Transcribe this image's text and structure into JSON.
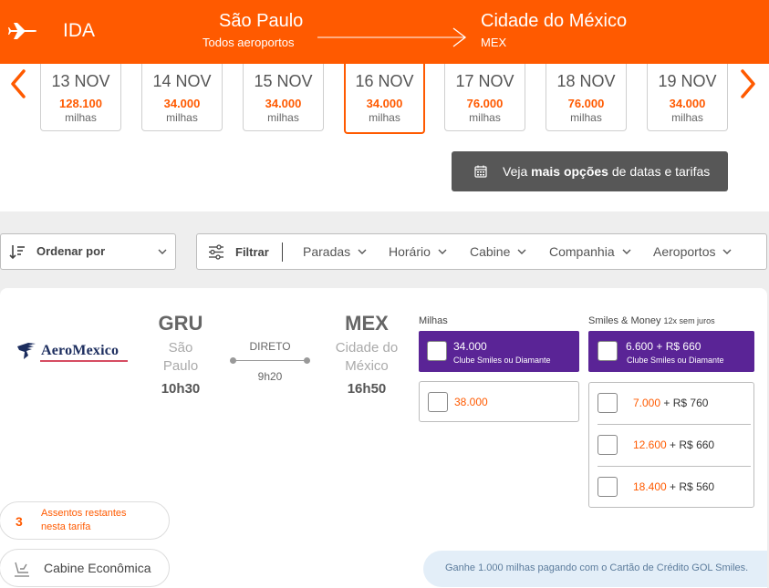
{
  "header": {
    "direction": "IDA",
    "origin": {
      "city": "São Paulo",
      "airports": "Todos aeroportos"
    },
    "destination": {
      "city": "Cidade do México",
      "code": "MEX"
    },
    "color": "#ff5a00"
  },
  "dates": [
    {
      "date": "13 NOV",
      "price": "128.100",
      "unit": "milhas",
      "selected": false
    },
    {
      "date": "14 NOV",
      "price": "34.000",
      "unit": "milhas",
      "selected": false
    },
    {
      "date": "15 NOV",
      "price": "34.000",
      "unit": "milhas",
      "selected": false
    },
    {
      "date": "16 NOV",
      "price": "34.000",
      "unit": "milhas",
      "selected": true
    },
    {
      "date": "17 NOV",
      "price": "76.000",
      "unit": "milhas",
      "selected": false
    },
    {
      "date": "18 NOV",
      "price": "76.000",
      "unit": "milhas",
      "selected": false
    },
    {
      "date": "19 NOV",
      "price": "34.000",
      "unit": "milhas",
      "selected": false
    }
  ],
  "more_options": {
    "prefix": "Veja",
    "bold": "mais opções",
    "suffix": "de datas e tarifas"
  },
  "sort": {
    "label": "Ordenar por"
  },
  "filters": {
    "label": "Filtrar",
    "options": [
      "Paradas",
      "Horário",
      "Cabine",
      "Companhia",
      "Aeroportos"
    ]
  },
  "flight": {
    "airline": "AeroMexico",
    "origin": {
      "code": "GRU",
      "city_line1": "São",
      "city_line2": "Paulo",
      "time": "10h30"
    },
    "stops": "DIRETO",
    "duration": "9h20",
    "destination": {
      "code": "MEX",
      "city_line1": "Cidade do",
      "city_line2": "México",
      "time": "16h50"
    }
  },
  "fares": {
    "miles_title": "Milhas",
    "money_title": "Smiles & Money",
    "money_note": "12x sem juros",
    "club_miles": {
      "price": "34.000",
      "label": "Clube Smiles ou Diamante"
    },
    "club_money": {
      "miles": "6.600",
      "cash": "+ R$ 660",
      "label": "Clube Smiles ou Diamante"
    },
    "regular_miles": "38.000",
    "money_options": [
      {
        "miles": "7.000",
        "cash": "+ R$ 760"
      },
      {
        "miles": "12.600",
        "cash": "+ R$ 660"
      },
      {
        "miles": "18.400",
        "cash": "+ R$ 560"
      }
    ]
  },
  "seats": {
    "count": "3",
    "line1": "Assentos restantes",
    "line2": "nesta tarifa"
  },
  "cabin": {
    "label": "Cabine Econômica"
  },
  "promo": {
    "text": "Ganhe 1.000 milhas pagando com o Cartão de Crédito GOL Smiles."
  }
}
